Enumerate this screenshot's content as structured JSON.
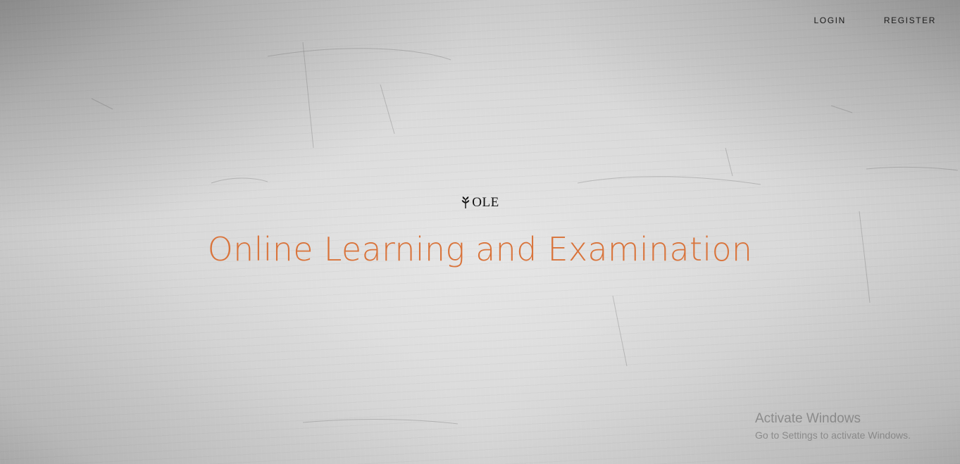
{
  "nav": {
    "login_label": "LOGIN",
    "register_label": "REGISTER"
  },
  "brand": {
    "icon": "sprout-icon",
    "text": "OLE"
  },
  "hero": {
    "title": "Online Learning and Examination"
  },
  "os_watermark": {
    "title": "Activate Windows",
    "subtitle": "Go to Settings to activate Windows."
  },
  "colors": {
    "accent": "#d9733a",
    "nav_text": "#1a1a1a",
    "background": "#d9d9d9"
  }
}
